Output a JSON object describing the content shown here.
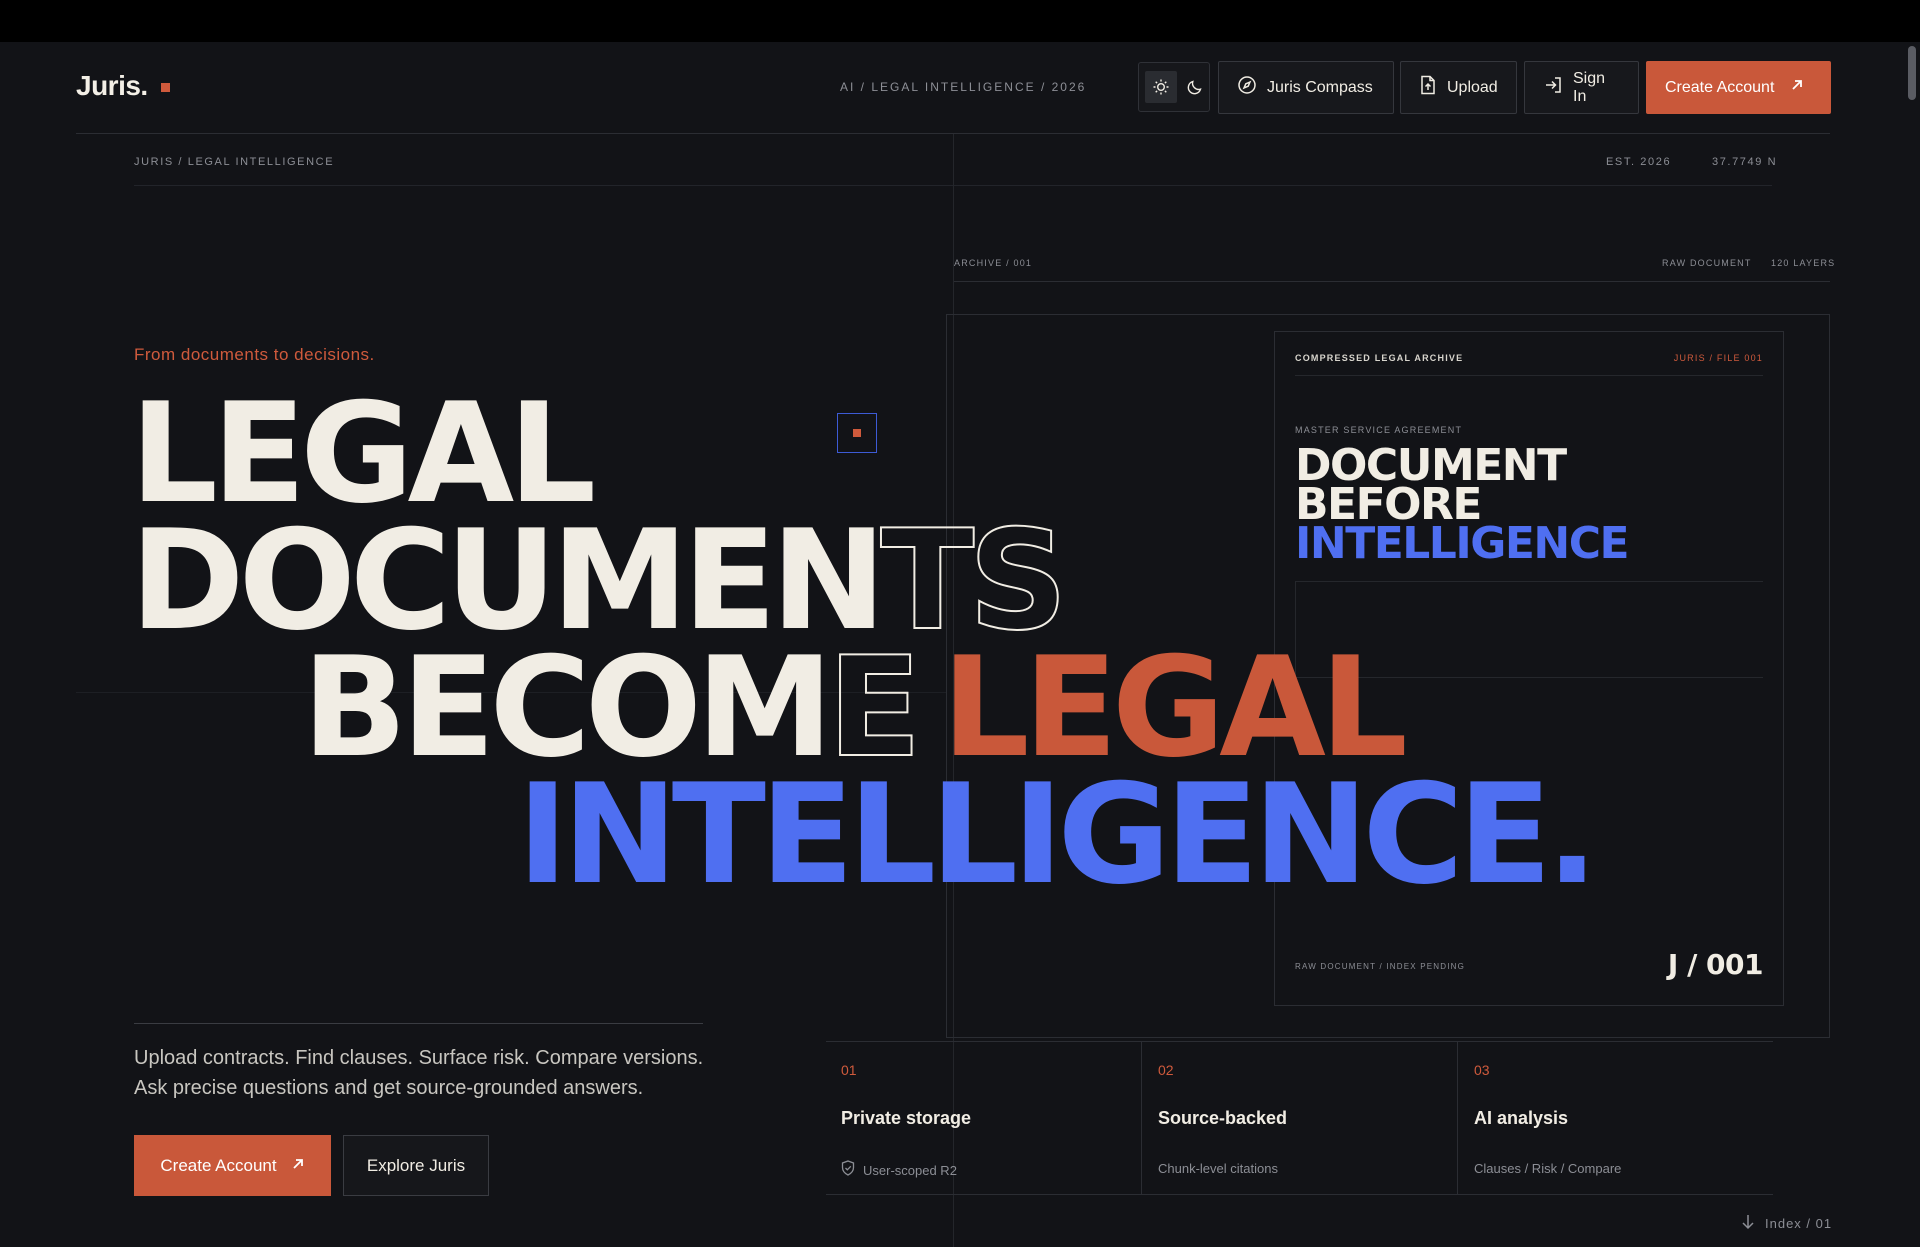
{
  "brand": {
    "name": "Juris.",
    "accent": "#c9583a",
    "blue": "#4f6ff1",
    "background": "#121317"
  },
  "nav": {
    "tagline": "AI / LEGAL INTELLIGENCE / 2026",
    "theme_light_icon": "sun-icon",
    "theme_dark_icon": "moon-icon",
    "compass_label": "Juris Compass",
    "upload_label": "Upload",
    "signin_label": "Sign In",
    "create_label": "Create Account"
  },
  "meta": {
    "breadcrumb": "JURIS / LEGAL INTELLIGENCE",
    "est": "EST. 2026",
    "coord": "37.7749 N"
  },
  "archive": {
    "label": "ARCHIVE / 001",
    "raw": "RAW DOCUMENT",
    "layers": "120 LAYERS"
  },
  "hero": {
    "lede": "From documents to decisions.",
    "line1": "LEGAL",
    "line2a": "DOCUMEN",
    "line2b": "TS",
    "line3a": "BECOM",
    "line3b": "E",
    "line3c": "LEGAL",
    "line4": "INTELLIGENCE."
  },
  "card": {
    "header_left": "COMPRESSED LEGAL ARCHIVE",
    "header_right": "JURIS / FILE 001",
    "kicker": "MASTER SERVICE AGREEMENT",
    "title1": "DOCUMENT",
    "title2": "BEFORE",
    "title3": "INTELLIGENCE",
    "footer_left": "RAW DOCUMENT / INDEX PENDING",
    "footer_right": "J / 001"
  },
  "intro": {
    "line1": "Upload contracts. Find clauses. Surface risk. Compare versions.",
    "line2": "Ask precise questions and get source-grounded answers.",
    "primary": "Create Account",
    "secondary": "Explore Juris"
  },
  "features": [
    {
      "num": "01",
      "title": "Private storage",
      "sub": "User-scoped R2",
      "icon": "shield-check-icon"
    },
    {
      "num": "02",
      "title": "Source-backed",
      "sub": "Chunk-level citations"
    },
    {
      "num": "03",
      "title": "AI analysis",
      "sub": "Clauses / Risk / Compare"
    }
  ],
  "index_label": "Index / 01"
}
